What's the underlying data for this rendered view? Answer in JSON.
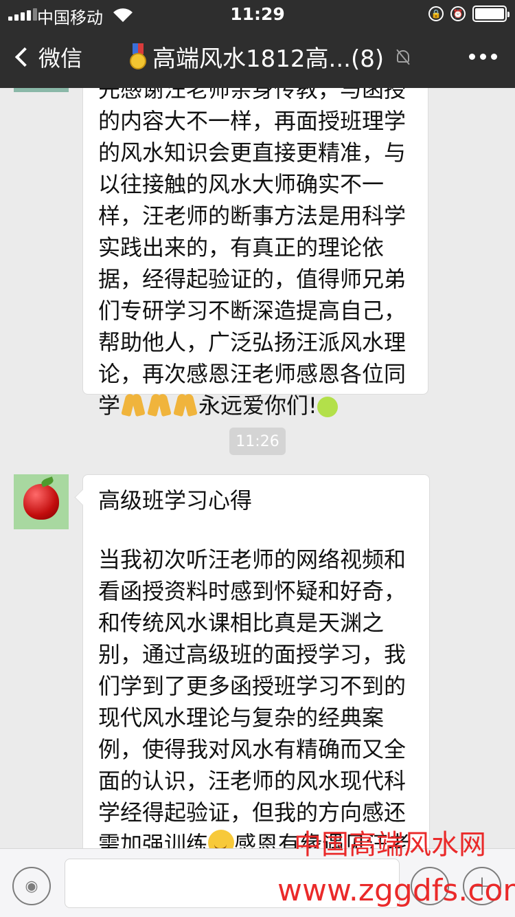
{
  "status_bar": {
    "carrier": "中国移动",
    "time": "11:29"
  },
  "nav": {
    "back_label": "微信",
    "chat_title": "高端风水1812高...(8)"
  },
  "messages": [
    {
      "paragraphs": [
        "先感谢汪老师亲身传教，与函授的内容大不一样，再面授班理学的风水知识会更直接更精准，与以往接触的风水大师确实不一样，汪老师的断事方法是用科学实践出来的，有真正的理论依据，经得起验证的，值得师兄弟们专研学习不断深造提高自己，帮助他人，广泛弘扬汪派风水理论，再次感恩汪老师感恩各位同学"
      ],
      "tail": "永远爱你们!"
    },
    {
      "timestamp": "11:26",
      "heading": "高级班学习心得",
      "body_a": "当我初次听汪老师的网络视频和看函授资料时感到怀疑和好奇，和传统风水课相比真是天渊之别，通过高级班的面授学习，我们学到了更多函授班学习不到的现代风水理论与复杂的经典案例，使得我对风水有精确而又全面的认识，汪老师的风水现代科学经得起验证，但我的方向感还需加强训练",
      "body_b": "感恩有缘遇见汪老师和同学们"
    }
  ],
  "watermark": {
    "line1": "中国高端风水网",
    "line2": "www.zggdfs.com"
  }
}
